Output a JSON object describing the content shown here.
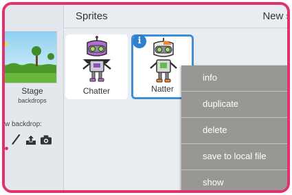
{
  "stage": {
    "label": "Stage",
    "sublabel": "backdrops",
    "new_backdrop_label": "w backdrop:"
  },
  "header": {
    "title": "Sprites",
    "new_sprite_label": "New s"
  },
  "sprites": [
    {
      "name": "Chatter",
      "selected": false
    },
    {
      "name": "Natter",
      "selected": true
    }
  ],
  "info_badge": "i",
  "context_menu": {
    "items": [
      "info",
      "duplicate",
      "delete",
      "save to local file",
      "show"
    ]
  },
  "colors": {
    "frame": "#e0336e",
    "selection": "#3c8ed9",
    "menu_bg": "#999794",
    "info_badge": "#2f7fd1"
  },
  "icons": [
    "paint-brush-icon",
    "upload-icon",
    "camera-icon",
    "info-icon"
  ]
}
